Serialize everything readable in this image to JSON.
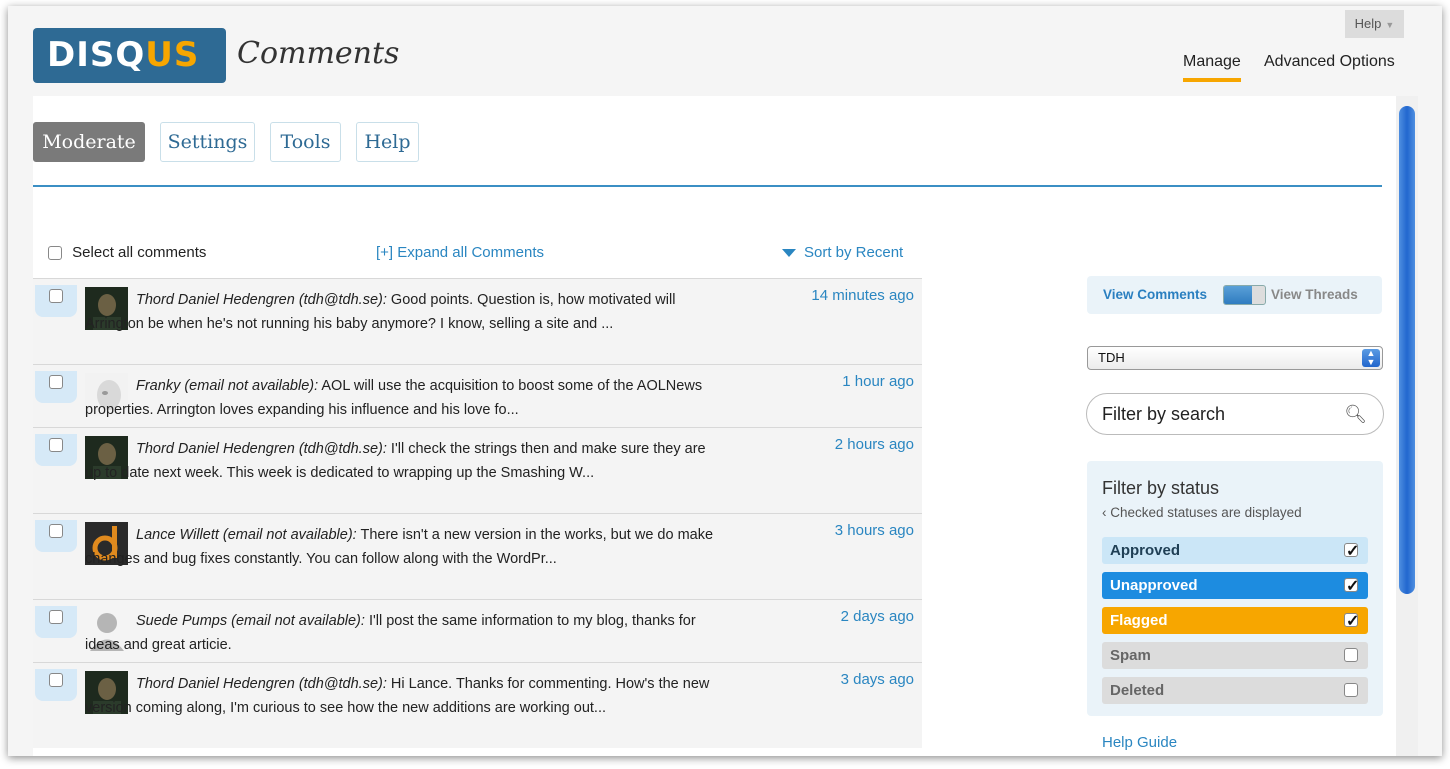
{
  "header": {
    "logo_part1": "DISQ",
    "logo_part2": "US",
    "title": "Comments",
    "help_label": "Help",
    "nav": [
      {
        "label": "Manage",
        "active": true
      },
      {
        "label": "Advanced Options",
        "active": false
      }
    ]
  },
  "tabs": [
    {
      "label": "Moderate",
      "active": true
    },
    {
      "label": "Settings",
      "active": false
    },
    {
      "label": "Tools",
      "active": false
    },
    {
      "label": "Help",
      "active": false
    }
  ],
  "list": {
    "select_all": "Select all comments",
    "expand_all": "[+] Expand all Comments",
    "sort": "Sort by Recent"
  },
  "comments": [
    {
      "author": "Thord Daniel Hedengren (tdh@tdh.se):",
      "text": "Good points. Question is, how motivated will Arrington be when he's not running his baby anymore? I know, selling a site and ...",
      "time": "14 minutes ago",
      "avatar": "photo-dark-icon"
    },
    {
      "author": "Franky (email not available):",
      "text": "AOL will use the acquisition to boost some of the AOLNews properties. Arrington loves expanding his influence and his love fo...",
      "time": "1 hour ago",
      "avatar": "photo-face-icon"
    },
    {
      "author": "Thord Daniel Hedengren (tdh@tdh.se):",
      "text": "I'll check the strings then and make sure they are up to date next week. This week is dedicated to wrapping up the Smashing W...",
      "time": "2 hours ago",
      "avatar": "photo-dark-icon"
    },
    {
      "author": "Lance Willett (email not available):",
      "text": "There isn't a new version in the works, but we do make changes and bug fixes constantly. You can follow along with the WordPr...",
      "time": "3 hours ago",
      "avatar": "logo-d-icon"
    },
    {
      "author": "Suede Pumps (email not available):",
      "text": "I'll post the same information to my blog, thanks for ideas and great articie.",
      "time": "2 days ago",
      "avatar": "default-user-icon"
    },
    {
      "author": "Thord Daniel Hedengren (tdh@tdh.se):",
      "text": "Hi Lance. Thanks for commenting. How's the new version coming along, I'm curious to see how the new additions are working out...",
      "time": "3 days ago",
      "avatar": "photo-dark-icon"
    }
  ],
  "sidebar": {
    "view_comments": "View Comments",
    "view_threads": "View Threads",
    "site_select": "TDH",
    "search_placeholder": "Filter by search",
    "status_title": "Filter by status",
    "status_sub": "‹ Checked statuses are displayed",
    "statuses": [
      {
        "label": "Approved",
        "checked": true,
        "bg": "#cbe6f7",
        "fg": "#1f3f55"
      },
      {
        "label": "Unapproved",
        "checked": true,
        "bg": "#1d8ce0",
        "fg": "#ffffff"
      },
      {
        "label": "Flagged",
        "checked": true,
        "bg": "#f7a600",
        "fg": "#ffffff"
      },
      {
        "label": "Spam",
        "checked": false,
        "bg": "#dcdcdc",
        "fg": "#666666"
      },
      {
        "label": "Deleted",
        "checked": false,
        "bg": "#dcdcdc",
        "fg": "#666666"
      }
    ],
    "help_guide": "Help Guide"
  }
}
